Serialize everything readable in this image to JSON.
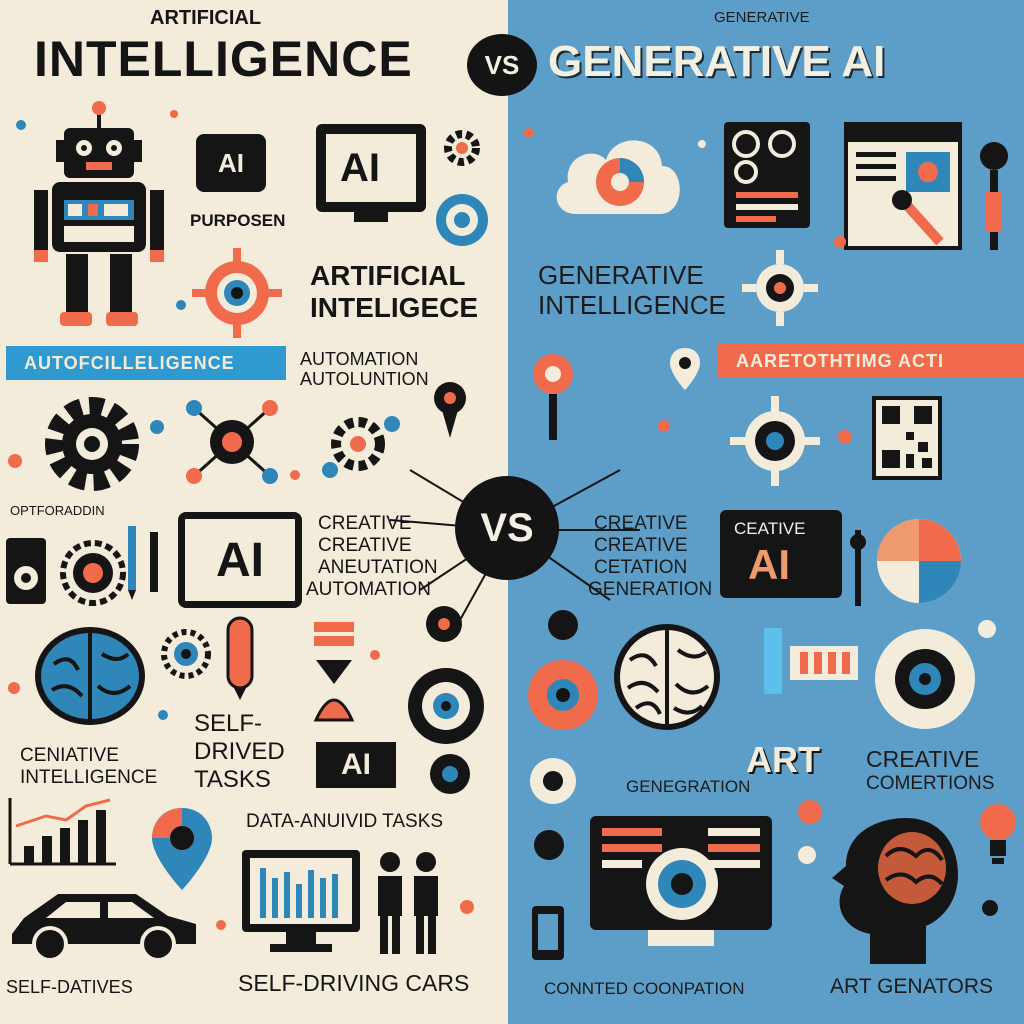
{
  "header": {
    "left_small": "ARTIFICIAL",
    "left_big": "INTELLIGENCE",
    "vs": "VS",
    "right_small": "GENERATIVE",
    "right_big": "GENERATIVE AI"
  },
  "left": {
    "ai_badge": "AI",
    "ai_screen": "AI",
    "purpose": "PURPOSEN",
    "title_line1": "ARTIFICIAL",
    "title_line2": "INTELIGECE",
    "banner": "AUTOFCILLELIGENCE",
    "automation_line1": "AUTOMATION",
    "automation_line2": "AUTOLUNTION",
    "foraddin": "OPTFORADDIN",
    "ai_speech": "AI",
    "creative_line1": "CREATIVE",
    "creative_line2": "CREATIVE",
    "creative_line3": "ANEUTATION",
    "creative_line4": "AUTOMATION",
    "ceniative_line1": "CENIATIVE",
    "ceniative_line2": "INTELLIGENCE",
    "self_line1": "SELF-",
    "self_line2": "DRIVED",
    "self_line3": "TASKS",
    "ai_small": "AI",
    "data_tasks": "DATA-ANUIVID TASKS",
    "bottom_left": "SELF-DATIVES",
    "bottom_right": "SELF-DRIVING CARS"
  },
  "center": {
    "vs": "VS"
  },
  "right": {
    "gen_line1": "GENERATIVE",
    "gen_line2": "INTELLIGENCE",
    "banner": "AARETOTHTIMG ACTI",
    "creative_line1": "CREATIVE",
    "creative_line2": "CREATIVE",
    "creative_line3": "CETATION",
    "creative_line4": "GENERATION",
    "creative_ai_small": "CEATIVE",
    "creative_ai_big": "AI",
    "art": "ART",
    "generation": "GENEGRATION",
    "creative_gen_line1": "CREATIVE",
    "creative_gen_line2": "COMERTIONS",
    "bottom_left": "CONNTED COONPATION",
    "bottom_right": "ART GENATORS"
  },
  "colors": {
    "left_bg": "#f3ecdb",
    "right_bg": "#5d9ec9",
    "accent_blue": "#2f86b8",
    "accent_orange": "#ef6b4c",
    "dark": "#151515"
  }
}
